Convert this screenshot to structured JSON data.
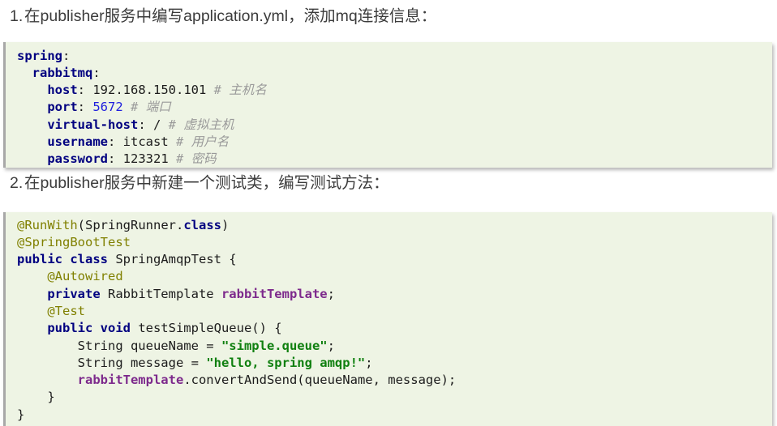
{
  "colors": {
    "page_background": "#ffffff",
    "code_background": "#eef4e4",
    "code_border": "#a8a8a8",
    "heading_text": "#3c3c3c",
    "keyword": "#000080",
    "number": "#2020dd",
    "comment": "#9a9a9a",
    "annotation": "#808000",
    "field": "#7d2a8c",
    "string": "#108010",
    "plain": "#1c1c1c"
  },
  "steps": [
    {
      "number": "1.",
      "text": "在publisher服务中编写application.yml，添加mq连接信息："
    },
    {
      "number": "2.",
      "text": "在publisher服务中新建一个测试类，编写测试方法："
    }
  ],
  "yaml_code": {
    "language": "yaml",
    "raw": "spring:\n  rabbitmq:\n    host: 192.168.150.101 # 主机名\n    port: 5672 # 端口\n    virtual-host: / # 虚拟主机\n    username: itcast # 用户名\n    password: 123321 # 密码",
    "lines": [
      {
        "indent": "",
        "tokens": [
          {
            "t": "key",
            "v": "spring"
          },
          {
            "t": "punct",
            "v": ":"
          }
        ]
      },
      {
        "indent": "  ",
        "tokens": [
          {
            "t": "key",
            "v": "rabbitmq"
          },
          {
            "t": "punct",
            "v": ":"
          }
        ]
      },
      {
        "indent": "    ",
        "tokens": [
          {
            "t": "key",
            "v": "host"
          },
          {
            "t": "punct",
            "v": ":"
          },
          {
            "t": "plain",
            "v": " 192.168.150.101 "
          },
          {
            "t": "cmt",
            "v": "# 主机名"
          }
        ]
      },
      {
        "indent": "    ",
        "tokens": [
          {
            "t": "key",
            "v": "port"
          },
          {
            "t": "punct",
            "v": ":"
          },
          {
            "t": "plain",
            "v": " "
          },
          {
            "t": "num",
            "v": "5672"
          },
          {
            "t": "plain",
            "v": " "
          },
          {
            "t": "cmt",
            "v": "# 端口"
          }
        ]
      },
      {
        "indent": "    ",
        "tokens": [
          {
            "t": "key",
            "v": "virtual-host"
          },
          {
            "t": "punct",
            "v": ":"
          },
          {
            "t": "plain",
            "v": " / "
          },
          {
            "t": "cmt",
            "v": "# 虚拟主机"
          }
        ]
      },
      {
        "indent": "    ",
        "tokens": [
          {
            "t": "key",
            "v": "username"
          },
          {
            "t": "punct",
            "v": ":"
          },
          {
            "t": "plain",
            "v": " itcast "
          },
          {
            "t": "cmt",
            "v": "# 用户名"
          }
        ]
      },
      {
        "indent": "    ",
        "tokens": [
          {
            "t": "key",
            "v": "password"
          },
          {
            "t": "punct",
            "v": ":"
          },
          {
            "t": "plain",
            "v": " 123321 "
          },
          {
            "t": "cmt",
            "v": "# 密码"
          }
        ]
      }
    ]
  },
  "java_code": {
    "language": "java",
    "raw": "@RunWith(SpringRunner.class)\n@SpringBootTest\npublic class SpringAmqpTest {\n    @Autowired\n    private RabbitTemplate rabbitTemplate;\n    @Test\n    public void testSimpleQueue() {\n        String queueName = \"simple.queue\";\n        String message = \"hello, spring amqp!\";\n        rabbitTemplate.convertAndSend(queueName, message);\n    }\n}",
    "lines": [
      {
        "indent": "",
        "tokens": [
          {
            "t": "anno",
            "v": "@RunWith"
          },
          {
            "t": "punct",
            "v": "("
          },
          {
            "t": "plain",
            "v": "SpringRunner."
          },
          {
            "t": "key",
            "v": "class"
          },
          {
            "t": "punct",
            "v": ")"
          }
        ]
      },
      {
        "indent": "",
        "tokens": [
          {
            "t": "anno",
            "v": "@SpringBootTest"
          }
        ]
      },
      {
        "indent": "",
        "tokens": [
          {
            "t": "key",
            "v": "public class"
          },
          {
            "t": "plain",
            "v": " SpringAmqpTest {"
          }
        ]
      },
      {
        "indent": "    ",
        "tokens": [
          {
            "t": "anno",
            "v": "@Autowired"
          }
        ]
      },
      {
        "indent": "    ",
        "tokens": [
          {
            "t": "key",
            "v": "private"
          },
          {
            "t": "plain",
            "v": " RabbitTemplate "
          },
          {
            "t": "field",
            "v": "rabbitTemplate"
          },
          {
            "t": "punct",
            "v": ";"
          }
        ]
      },
      {
        "indent": "    ",
        "tokens": [
          {
            "t": "anno",
            "v": "@Test"
          }
        ]
      },
      {
        "indent": "    ",
        "tokens": [
          {
            "t": "key",
            "v": "public void"
          },
          {
            "t": "plain",
            "v": " testSimpleQueue() {"
          }
        ]
      },
      {
        "indent": "        ",
        "tokens": [
          {
            "t": "plain",
            "v": "String queueName = "
          },
          {
            "t": "str",
            "v": "\"simple.queue\""
          },
          {
            "t": "punct",
            "v": ";"
          }
        ]
      },
      {
        "indent": "        ",
        "tokens": [
          {
            "t": "plain",
            "v": "String message = "
          },
          {
            "t": "str",
            "v": "\"hello, spring amqp!\""
          },
          {
            "t": "punct",
            "v": ";"
          }
        ]
      },
      {
        "indent": "        ",
        "tokens": [
          {
            "t": "field",
            "v": "rabbitTemplate"
          },
          {
            "t": "plain",
            "v": ".convertAndSend(queueName, message);"
          }
        ]
      },
      {
        "indent": "    ",
        "tokens": [
          {
            "t": "plain",
            "v": "}"
          }
        ]
      },
      {
        "indent": "",
        "tokens": [
          {
            "t": "plain",
            "v": "}"
          }
        ]
      }
    ]
  }
}
